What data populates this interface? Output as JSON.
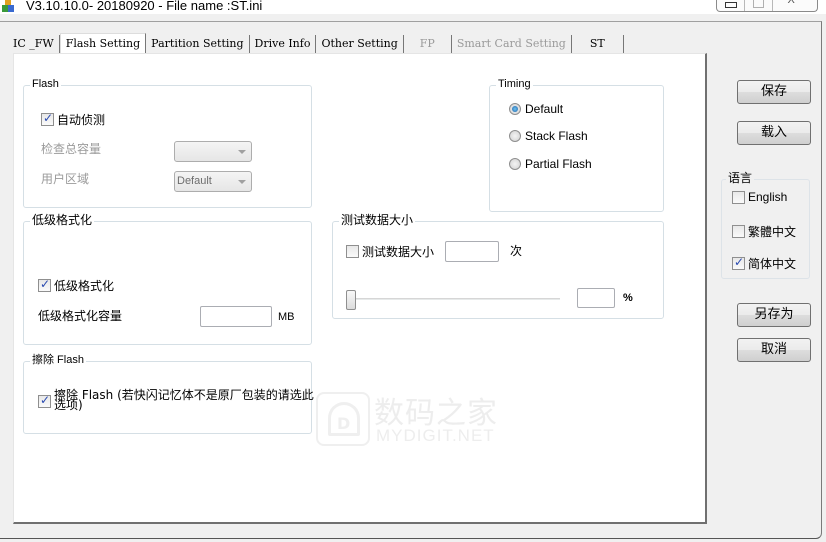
{
  "window": {
    "title": "V3.10.10.0- 20180920 - File name :ST.ini",
    "controls": [
      "minimize",
      "maximize",
      "close"
    ]
  },
  "tabs": [
    {
      "label": "IC _FW",
      "state": "normal"
    },
    {
      "label": "Flash Setting",
      "state": "active"
    },
    {
      "label": "Partition Setting",
      "state": "normal"
    },
    {
      "label": "Drive Info",
      "state": "normal"
    },
    {
      "label": "Other Setting",
      "state": "normal"
    },
    {
      "label": "FP",
      "state": "disabled"
    },
    {
      "label": "Smart Card Setting",
      "state": "disabled"
    },
    {
      "label": "ST",
      "state": "normal"
    }
  ],
  "flash_group": {
    "title": "Flash",
    "auto_detect": {
      "label": "自动侦测",
      "checked": true
    },
    "check_capacity": {
      "label": "检查总容量",
      "value": "",
      "enabled": false
    },
    "user_area": {
      "label": "用户区域",
      "value": "Default",
      "enabled": false
    }
  },
  "low_format_group": {
    "title": "低级格式化",
    "low_format": {
      "label": "低级格式化",
      "checked": true
    },
    "capacity": {
      "label": "低级格式化容量",
      "value": "",
      "unit": "MB"
    }
  },
  "erase_group": {
    "title": "擦除 Flash",
    "erase": {
      "label_line1": "擦除 Flash (若快闪记忆体不是原厂包装的请选此",
      "label_line2": "选项)",
      "checked": true
    }
  },
  "timing_group": {
    "title": "Timing",
    "options": [
      {
        "label": "Default",
        "selected": true
      },
      {
        "label": "Stack Flash",
        "selected": false
      },
      {
        "label": "Partial Flash",
        "selected": false
      }
    ]
  },
  "test_data_group": {
    "title": "测试数据大小",
    "test_data": {
      "label": "测试数据大小",
      "checked": false,
      "value": "",
      "unit": "次"
    },
    "percent": {
      "slider_value": 0,
      "value": "",
      "unit": "%"
    }
  },
  "side": {
    "save_label": "保存",
    "load_label": "载入",
    "language": {
      "title": "语言",
      "options": [
        {
          "label": "English",
          "checked": false
        },
        {
          "label": "繁體中文",
          "checked": false
        },
        {
          "label": "简体中文",
          "checked": true
        }
      ]
    },
    "save_as_label": "另存为",
    "cancel_label": "取消"
  },
  "watermark": {
    "cn": "数码之家",
    "en": "MYDIGIT.NET"
  }
}
